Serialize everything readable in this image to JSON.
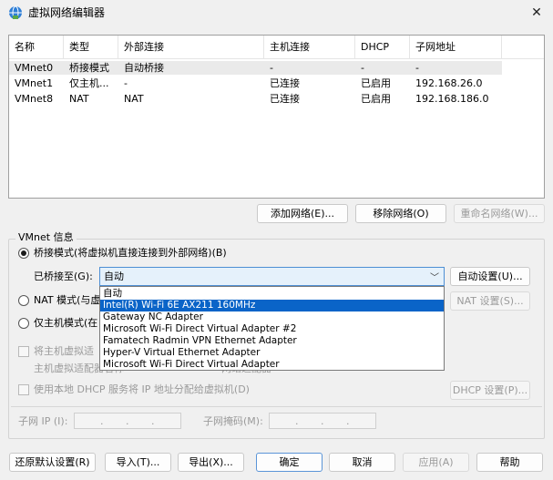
{
  "window": {
    "title": "虚拟网络编辑器",
    "close_symbol": "✕"
  },
  "table": {
    "headers": [
      "名称",
      "类型",
      "外部连接",
      "主机连接",
      "DHCP",
      "子网地址"
    ],
    "rows": [
      [
        "VMnet0",
        "桥接模式",
        "自动桥接",
        "-",
        "-",
        "-"
      ],
      [
        "VMnet1",
        "仅主机...",
        "-",
        "已连接",
        "已启用",
        "192.168.26.0"
      ],
      [
        "VMnet8",
        "NAT",
        "NAT",
        "已连接",
        "已启用",
        "192.168.186.0"
      ]
    ]
  },
  "net_buttons": {
    "add": "添加网络(E)...",
    "remove": "移除网络(O)",
    "rename": "重命名网络(W)..."
  },
  "vmnet_info": {
    "group_label": "VMnet 信息",
    "bridged_label": "桥接模式(将虚拟机直接连接到外部网络)(B)",
    "bridged_to_label": "已桥接至(G):",
    "bridged_to_value": "自动",
    "auto_settings": "自动设置(U)...",
    "nat_label": "NAT 模式(与虚",
    "nat_settings": "NAT 设置(S)...",
    "host_only_label": "仅主机模式(在",
    "connect_host_adapter": "将主机虚拟适",
    "host_adapter_name": "主机虚拟适配器名称",
    "host_adapter_suffix": "网络适配器",
    "use_dhcp": "使用本地 DHCP 服务将 IP 地址分配给虚拟机(D)",
    "dhcp_settings": "DHCP 设置(P)...",
    "subnet_ip_label": "子网 IP (I):",
    "subnet_mask_label": "子网掩码(M):"
  },
  "dropdown_options": [
    "自动",
    "Intel(R) Wi-Fi 6E AX211 160MHz",
    "Gateway NC Adapter",
    "Microsoft Wi-Fi Direct Virtual Adapter #2",
    "Famatech Radmin VPN Ethernet Adapter",
    "Hyper-V Virtual Ethernet Adapter",
    "Microsoft Wi-Fi Direct Virtual Adapter"
  ],
  "dropdown_highlighted_index": 1,
  "bottom_buttons": {
    "restore": "还原默认设置(R)",
    "import": "导入(T)...",
    "export": "导出(X)...",
    "ok": "确定",
    "cancel": "取消",
    "apply": "应用(A)",
    "help": "帮助"
  },
  "colors": {
    "accent": "#0a64c8",
    "combo_bg": "#e5f1fb",
    "combo_border": "#4d8fd4"
  }
}
